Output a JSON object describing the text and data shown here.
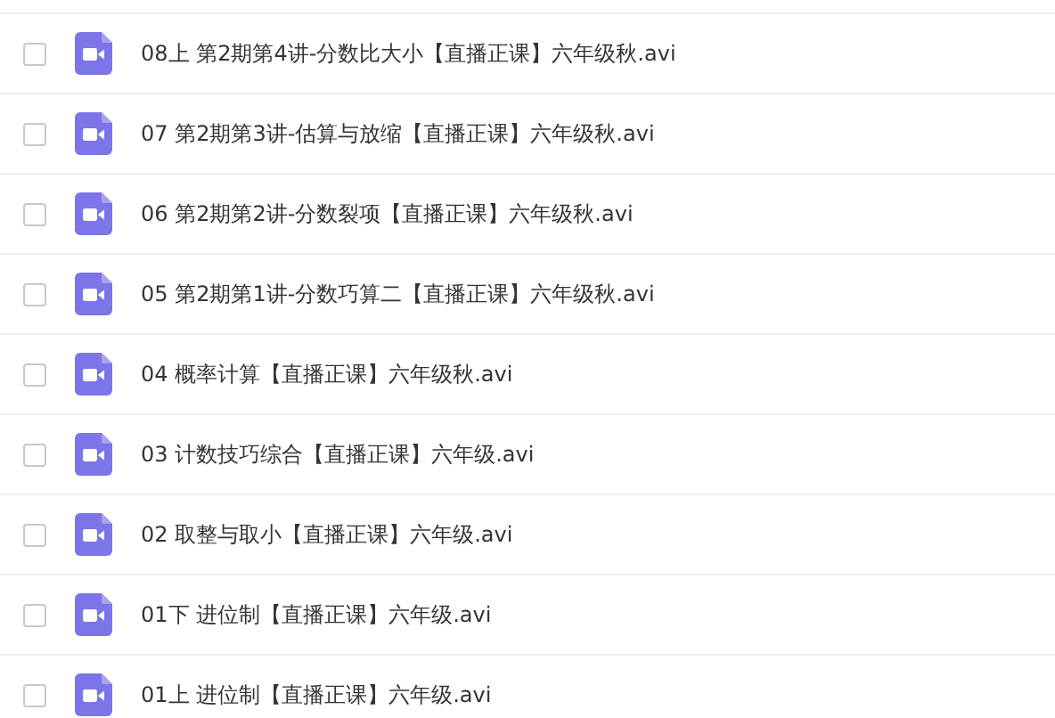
{
  "files": [
    {
      "name": "08上 第2期第4讲-分数比大小【直播正课】六年级秋.avi",
      "checked": false
    },
    {
      "name": "07 第2期第3讲-估算与放缩【直播正课】六年级秋.avi",
      "checked": false
    },
    {
      "name": "06 第2期第2讲-分数裂项【直播正课】六年级秋.avi",
      "checked": false
    },
    {
      "name": "05 第2期第1讲-分数巧算二【直播正课】六年级秋.avi",
      "checked": false
    },
    {
      "name": "04 概率计算【直播正课】六年级秋.avi",
      "checked": false
    },
    {
      "name": "03 计数技巧综合【直播正课】六年级.avi",
      "checked": false
    },
    {
      "name": "02 取整与取小【直播正课】六年级.avi",
      "checked": false
    },
    {
      "name": "01下 进位制【直播正课】六年级.avi",
      "checked": false
    },
    {
      "name": "01上 进位制【直播正课】六年级.avi",
      "checked": false
    }
  ]
}
